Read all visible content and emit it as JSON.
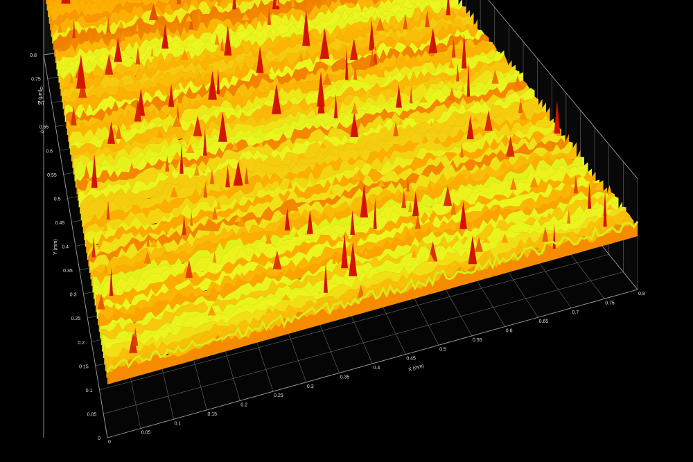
{
  "chart_data": {
    "type": "surface3d",
    "colors": {
      "background": "#000000",
      "low": "#e9f524",
      "mid": "#ffb300",
      "high": "#cc0000",
      "grid": "#6b6b6b"
    },
    "x_axis": {
      "label": "X (mm)",
      "range": [
        0,
        0.8
      ],
      "ticks": [
        "0",
        "0.05",
        "0.1",
        "0.15",
        "0.2",
        "0.25",
        "0.3",
        "0.35",
        "0.4",
        "0.45",
        "0.5",
        "0.55",
        "0.6",
        "0.65",
        "0.7",
        "0.75",
        "0.8"
      ]
    },
    "y_axis": {
      "label": "Y (mm)",
      "range": [
        0,
        0.8
      ],
      "ticks": [
        "0",
        "0.05",
        "0.1",
        "0.15",
        "0.2",
        "0.25",
        "0.3",
        "0.35",
        "0.4",
        "0.45",
        "0.5",
        "0.55",
        "0.6",
        "0.65",
        "0.7",
        "0.75",
        "0.8"
      ]
    },
    "z_axis": {
      "label": "Z (µm)",
      "range": [
        -5,
        0
      ],
      "ticks": [
        "-5",
        "0"
      ]
    },
    "grid": true
  }
}
